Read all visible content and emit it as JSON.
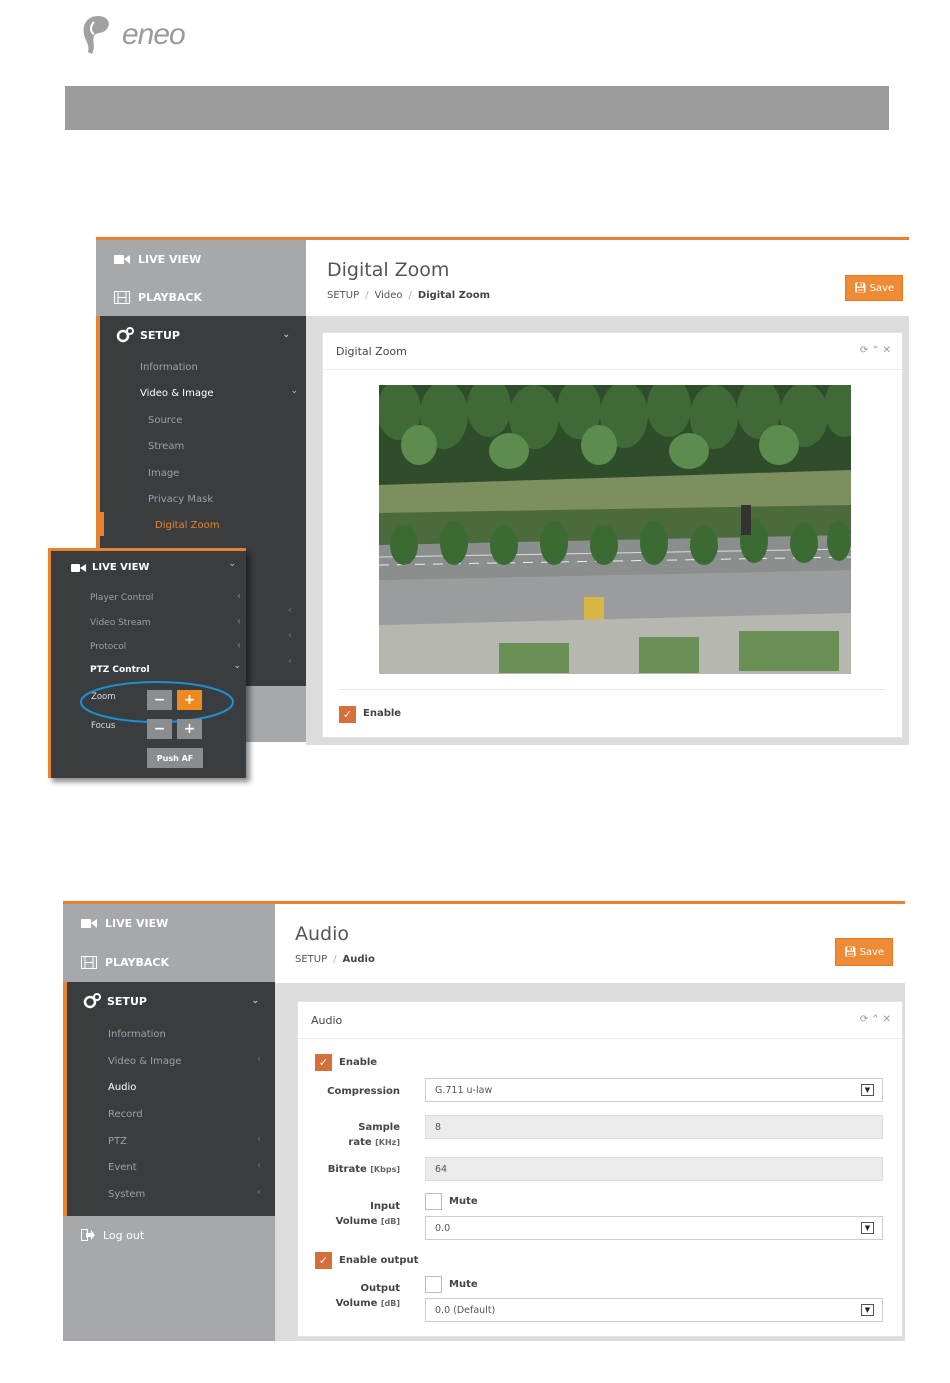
{
  "brand": {
    "logo_text": "eneo"
  },
  "zoom_ui": {
    "nav": {
      "live_view": "LIVE VIEW",
      "playback": "PLAYBACK",
      "setup": "SETUP"
    },
    "setup_items": [
      "Information",
      "Video & Image"
    ],
    "video_items": [
      "Source",
      "Stream",
      "Image",
      "Privacy Mask",
      "Digital Zoom"
    ],
    "page_title": "Digital Zoom",
    "breadcrumb": [
      "SETUP",
      "Video",
      "Digital Zoom"
    ],
    "save_label": "Save",
    "panel_title": "Digital Zoom",
    "enable_label": "Enable",
    "enable_checked": true
  },
  "popout": {
    "title": "LIVE VIEW",
    "items": [
      "Player Control",
      "Video Stream",
      "Protocol"
    ],
    "ptz_label": "PTZ Control",
    "zoom_label": "Zoom",
    "focus_label": "Focus",
    "minus": "−",
    "plus": "+",
    "push_af": "Push AF"
  },
  "audio_ui": {
    "nav": {
      "live_view": "LIVE VIEW",
      "playback": "PLAYBACK",
      "setup": "SETUP",
      "logout": "Log out"
    },
    "setup_items": [
      "Information",
      "Video & Image",
      "Audio",
      "Record",
      "PTZ",
      "Event",
      "System"
    ],
    "page_title": "Audio",
    "breadcrumb": [
      "SETUP",
      "Audio"
    ],
    "save_label": "Save",
    "panel_title": "Audio",
    "enable_label": "Enable",
    "compression_label": "Compression",
    "compression_value": "G.711 u-law",
    "sample_rate_label": "Sample",
    "sample_rate_label2": "rate",
    "sample_rate_unit": "[KHz]",
    "sample_rate_value": "8",
    "bitrate_label": "Bitrate",
    "bitrate_unit": "[Kbps]",
    "bitrate_value": "64",
    "input_label": "Input",
    "input_label2": "Volume",
    "input_unit": "[dB]",
    "mute_label": "Mute",
    "input_value": "0.0",
    "enable_output_label": "Enable output",
    "output_label": "Output",
    "output_label2": "Volume",
    "output_unit": "[dB]",
    "output_value": "0.0 (Default)"
  }
}
